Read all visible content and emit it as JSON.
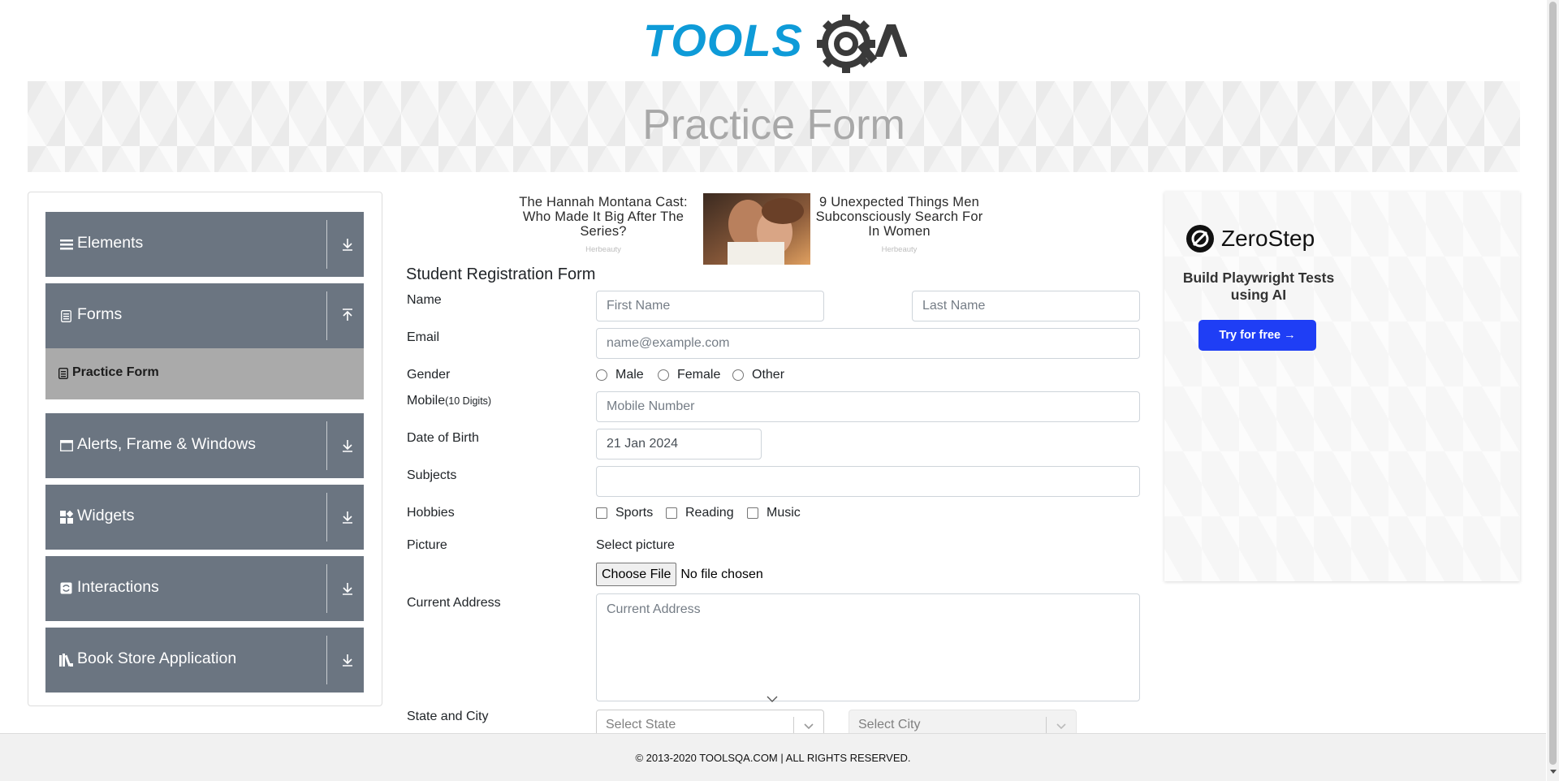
{
  "header": {
    "logo_text": "TOOLSQA",
    "banner_title": "Practice Form"
  },
  "sidebar": {
    "groups": [
      {
        "label": "Elements",
        "icon": "list-icon",
        "arrow": "download-icon"
      },
      {
        "label": "Forms",
        "icon": "clipboard-icon",
        "arrow": "upload-icon"
      },
      {
        "label": "Alerts, Frame & Windows",
        "icon": "window-icon",
        "arrow": "download-icon"
      },
      {
        "label": "Widgets",
        "icon": "widgets-icon",
        "arrow": "download-icon"
      },
      {
        "label": "Interactions",
        "icon": "interaction-icon",
        "arrow": "download-icon"
      },
      {
        "label": "Book Store Application",
        "icon": "books-icon",
        "arrow": "download-icon"
      }
    ],
    "active_item": "Practice Form"
  },
  "ads": {
    "left": {
      "headline": "The Hannah Montana Cast: Who Made It Big After The Series?",
      "source": "Herbeauty"
    },
    "right": {
      "headline": "9 Unexpected Things Men Subconsciously Search For In Women",
      "source": "Herbeauty"
    },
    "side": {
      "brand": "ZeroStep",
      "tagline": "Build Playwright Tests using AI",
      "cta": "Try for free →"
    }
  },
  "form": {
    "title": "Student Registration Form",
    "labels": {
      "name": "Name",
      "email": "Email",
      "gender": "Gender",
      "mobile": "Mobile",
      "mobile_hint": "(10 Digits)",
      "dob": "Date of Birth",
      "subjects": "Subjects",
      "hobbies": "Hobbies",
      "picture": "Picture",
      "address": "Current Address",
      "state_city": "State and City"
    },
    "placeholders": {
      "first_name": "First Name",
      "last_name": "Last Name",
      "email": "name@example.com",
      "mobile": "Mobile Number",
      "address": "Current Address",
      "state": "Select State",
      "city": "Select City"
    },
    "dob_value": "21 Jan 2024",
    "gender_options": [
      "Male",
      "Female",
      "Other"
    ],
    "hobby_options": [
      "Sports",
      "Reading",
      "Music"
    ],
    "picture": {
      "prompt": "Select picture",
      "button": "Choose File",
      "status": "No file chosen"
    }
  },
  "footer": {
    "text": "© 2013-2020 TOOLSQA.COM | ALL RIGHTS RESERVED."
  },
  "colors": {
    "nav_bg": "#6b7581",
    "active_bg": "#aaaaaa",
    "logo_blue": "#0e9bd8",
    "logo_dark": "#3a3a3a",
    "cta_blue": "#1f3ef5"
  }
}
